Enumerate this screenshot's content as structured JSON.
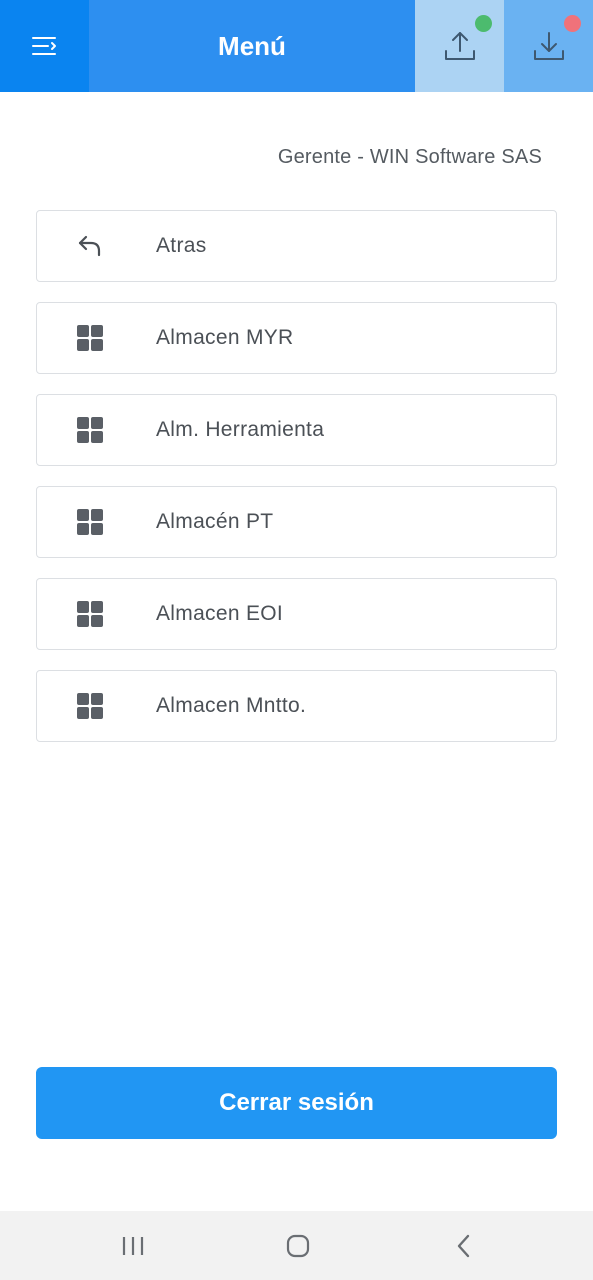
{
  "header": {
    "title": "Menú",
    "upload_status_color": "#4cbb6e",
    "download_status_color": "#f0727a"
  },
  "user_role": "Gerente - WIN Software SAS",
  "menu": {
    "items": [
      {
        "label": "Atras",
        "icon": "back-arrow-icon"
      },
      {
        "label": "Almacen MYR",
        "icon": "grid-icon"
      },
      {
        "label": "Alm. Herramienta",
        "icon": "grid-icon"
      },
      {
        "label": "Almacén PT",
        "icon": "grid-icon"
      },
      {
        "label": "Almacen EOI",
        "icon": "grid-icon"
      },
      {
        "label": "Almacen Mntto.",
        "icon": "grid-icon"
      }
    ]
  },
  "logout_label": "Cerrar sesión",
  "colors": {
    "primary": "#2196f3",
    "header_dark": "#0a84f0"
  }
}
